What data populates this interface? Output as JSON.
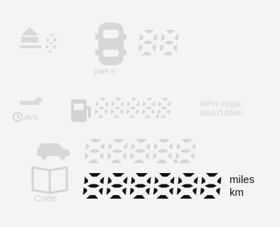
{
  "display": {
    "gear_digit": "8",
    "park_label": "park s",
    "sensor_digits": "88",
    "avg_label": "AVG",
    "fuel_digits": "8888.8",
    "fuel_units_line1": "MPH mi/gal",
    "fuel_units_line2": "km/L/100km",
    "trip_digits": "8888.8",
    "odometer_digits": "888888",
    "unit_miles": "miles",
    "unit_km": "km",
    "code_label": "Code"
  },
  "colors": {
    "background": "#f4f4f4",
    "ghost_segment": "#d6d6d6",
    "active_segment": "#111111"
  },
  "icons": [
    "vehicle-top-icon",
    "gear-arrow-icon",
    "fuel-pump-icon",
    "oil-can-icon",
    "clock-icon",
    "car-side-icon",
    "book-icon"
  ]
}
